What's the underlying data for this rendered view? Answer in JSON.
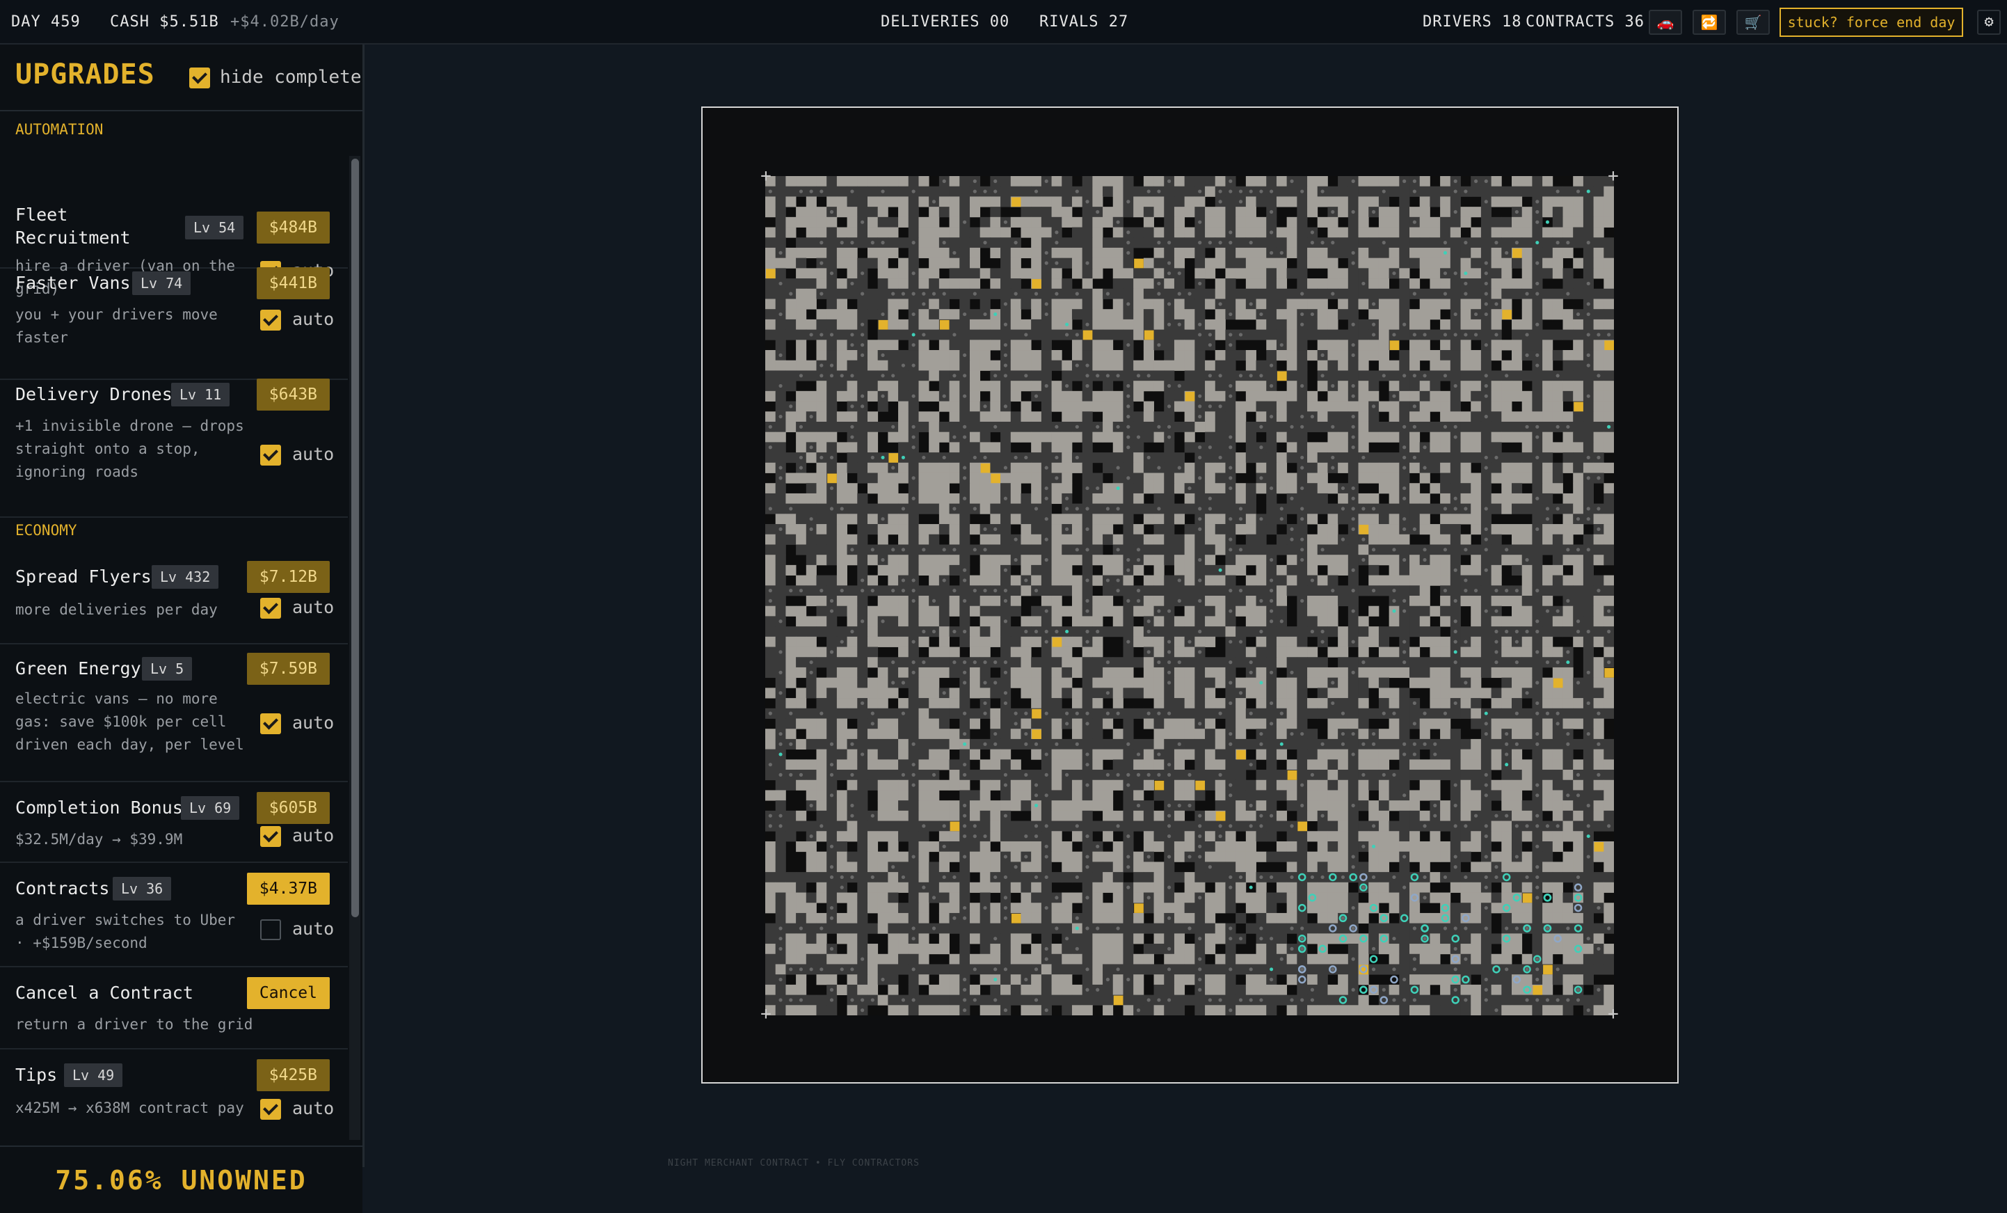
{
  "topbar": {
    "day": "DAY 459",
    "cash": "CASH $5.51B",
    "cash_rate": "+$4.02B/day",
    "deliveries": "DELIVERIES 00",
    "rivals": "RIVALS 27",
    "drivers": "DRIVERS 18",
    "contracts": "CONTRACTS 36",
    "icons": [
      "car-icon",
      "refresh-icon",
      "cart-icon"
    ],
    "force_end_label": "stuck? force end day",
    "settings_icon": "gear-icon"
  },
  "sidebar": {
    "title": "UPGRADES",
    "hide_complete_label": "hide complete",
    "hide_complete_checked": true,
    "sections": [
      {
        "label": "AUTOMATION"
      },
      {
        "label": "ECONOMY"
      }
    ],
    "upgrades": [
      {
        "name": "Fleet Recruitment",
        "level": "Lv 54",
        "price": "$484B",
        "desc": "hire a driver (van on the grid)",
        "auto_label": "auto",
        "auto": true
      },
      {
        "name": "Faster Vans",
        "level": "Lv 74",
        "price": "$441B",
        "desc": "you + your drivers move faster",
        "auto_label": "auto",
        "auto": true
      },
      {
        "name": "Delivery Drones",
        "level": "Lv 11",
        "price": "$643B",
        "desc": "+1 invisible drone — drops straight onto a stop, ignoring roads",
        "auto_label": "auto",
        "auto": true
      },
      {
        "name": "Spread Flyers",
        "level": "Lv 432",
        "price": "$7.12B",
        "desc": "more deliveries per day",
        "auto_label": "auto",
        "auto": true
      },
      {
        "name": "Green Energy",
        "level": "Lv 5",
        "price": "$7.59B",
        "desc": "electric vans — no more gas: save $100k per cell driven each day, per level",
        "auto_label": "auto",
        "auto": true
      },
      {
        "name": "Completion Bonus",
        "level": "Lv 69",
        "price": "$605B",
        "desc": "$32.5M/day → $39.9M",
        "auto_label": "auto",
        "auto": true
      },
      {
        "name": "Contracts",
        "level": "Lv 36",
        "price": "$4.37B",
        "desc": "a driver switches to Uber · +$159B/second",
        "auto_label": "auto",
        "auto": false
      },
      {
        "name": "Cancel a Contract",
        "button": "Cancel",
        "desc": "return a driver to the grid"
      },
      {
        "name": "Tips",
        "level": "Lv 49",
        "price": "$425B",
        "desc": "x425M → x638M contract pay",
        "auto_label": "auto",
        "auto": true
      }
    ],
    "unowned": "75.06% UNOWNED"
  },
  "board": {
    "grid_cols": 83,
    "grid_rows": 82,
    "colors": {
      "building": "#a29f99",
      "road": "#3a3a3a",
      "empty": "#0e0e0e",
      "stop": "#e3b22c",
      "driver": "#3fd0b8",
      "rival": "#8fa7c7"
    }
  },
  "footer_text": "NIGHT MERCHANT CONTRACT • FLY CONTRACTORS"
}
